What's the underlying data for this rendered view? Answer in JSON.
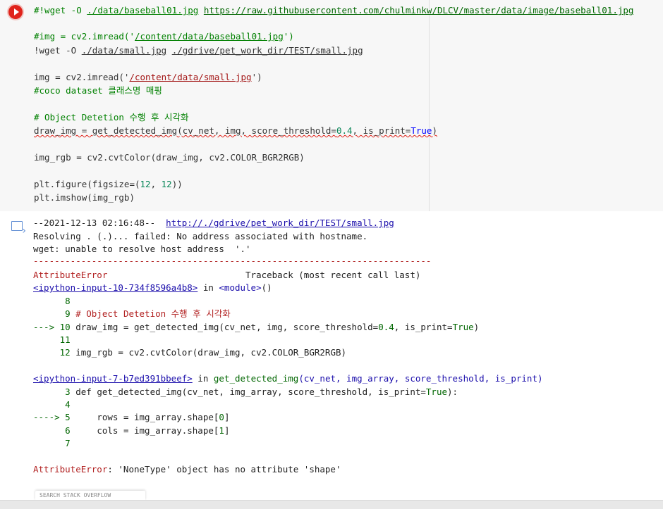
{
  "code": {
    "lines": [
      {
        "pre": "#!wget -O ",
        "path": "./data/baseball01.jpg",
        "mid": " ",
        "url": "https://raw.githubusercontent.com/chulminkw/DLCV/master/data/image/baseball01.jpg"
      },
      {
        "text": ""
      },
      {
        "pre": "#img = cv2.imread('",
        "path": "/content/data/baseball01.jpg",
        "post": "')"
      },
      {
        "pre": "!wget -O ",
        "path1": "./data/small.jpg",
        "mid": " ",
        "path2": "./gdrive/pet_work_dir/TEST/small.jpg"
      },
      {
        "text": ""
      },
      {
        "pre": "img = cv2.imread('",
        "path": "/content/data/small.jpg",
        "post": "')"
      },
      {
        "comment": "#coco dataset 클래스명 매핑"
      },
      {
        "text": ""
      },
      {
        "comment": "# Object Detetion 수행 후 시각화"
      },
      {
        "call": "draw_img = get_detected_img(cv_net, img, score_threshold=",
        "num": "0.4",
        "mid": ", is_print=",
        "kw": "True",
        "post": ")"
      },
      {
        "text": ""
      },
      {
        "text": "img_rgb = cv2.cvtColor(draw_img, cv2.COLOR_BGR2RGB)"
      },
      {
        "text": ""
      },
      {
        "pre": "plt.figure(figsize=(",
        "num1": "12",
        "sep": ", ",
        "num2": "12",
        "post": "))"
      },
      {
        "text": "plt.imshow(img_rgb)"
      }
    ]
  },
  "output": {
    "wget_line_pre": "--2021-12-13 02:16:48--  ",
    "wget_url": "http://./gdrive/pet_work_dir/TEST/small.jpg",
    "resolving": "Resolving . (.)... failed: No address associated with hostname.",
    "unable": "wget: unable to resolve host address  '.'",
    "dashes": "---------------------------------------------------------------------------",
    "error_name": "AttributeError",
    "traceback": "                          Traceback (most recent call last)",
    "frame1_file": "<ipython-input-10-734f8596a4b8>",
    "frame1_in": " in ",
    "frame1_mod": "<module>",
    "frame1_paren": "()",
    "f1_l8": "      8",
    "f1_l9_num": "      9",
    "f1_l9_text": " # Object Detetion 수행 후 시각화",
    "f1_l10_arrow": "---> 10",
    "f1_l10_pre": " draw_img = get_detected_img(cv_net, img, score_threshold=",
    "f1_l10_num": "0.4",
    "f1_l10_mid": ", is_print=",
    "f1_l10_kw": "True",
    "f1_l10_post": ")",
    "f1_l11": "     11",
    "f1_l12_num": "     12",
    "f1_l12_text": " img_rgb = cv2.cvtColor(draw_img, cv2.COLOR_BGR2RGB)",
    "frame2_file": "<ipython-input-7-b7ed391bbeef>",
    "frame2_in": " in ",
    "frame2_func": "get_detected_img",
    "frame2_args": "(cv_net, img_array, score_threshold, is_print)",
    "f2_l3_num": "      3",
    "f2_l3_pre": " def get_detected_img(cv_net, img_array, score_threshold, is_print=",
    "f2_l3_kw": "True",
    "f2_l3_post": "):",
    "f2_l4": "      4",
    "f2_l5_arrow": "----> 5",
    "f2_l5_pre": "     rows = img_array.shape[",
    "f2_l5_num": "0",
    "f2_l5_post": "]",
    "f2_l6_num": "      6",
    "f2_l6_pre": "     cols = img_array.shape[",
    "f2_l6_num2": "1",
    "f2_l6_post": "]",
    "f2_l7": "      7",
    "final_err": "AttributeError",
    "final_msg": ": 'NoneType' object has no attribute 'shape'",
    "chip_text": "SEARCH STACK OVERFLOW"
  },
  "icons": {
    "run": "play-circle-icon",
    "output": "output-redirect-icon"
  }
}
